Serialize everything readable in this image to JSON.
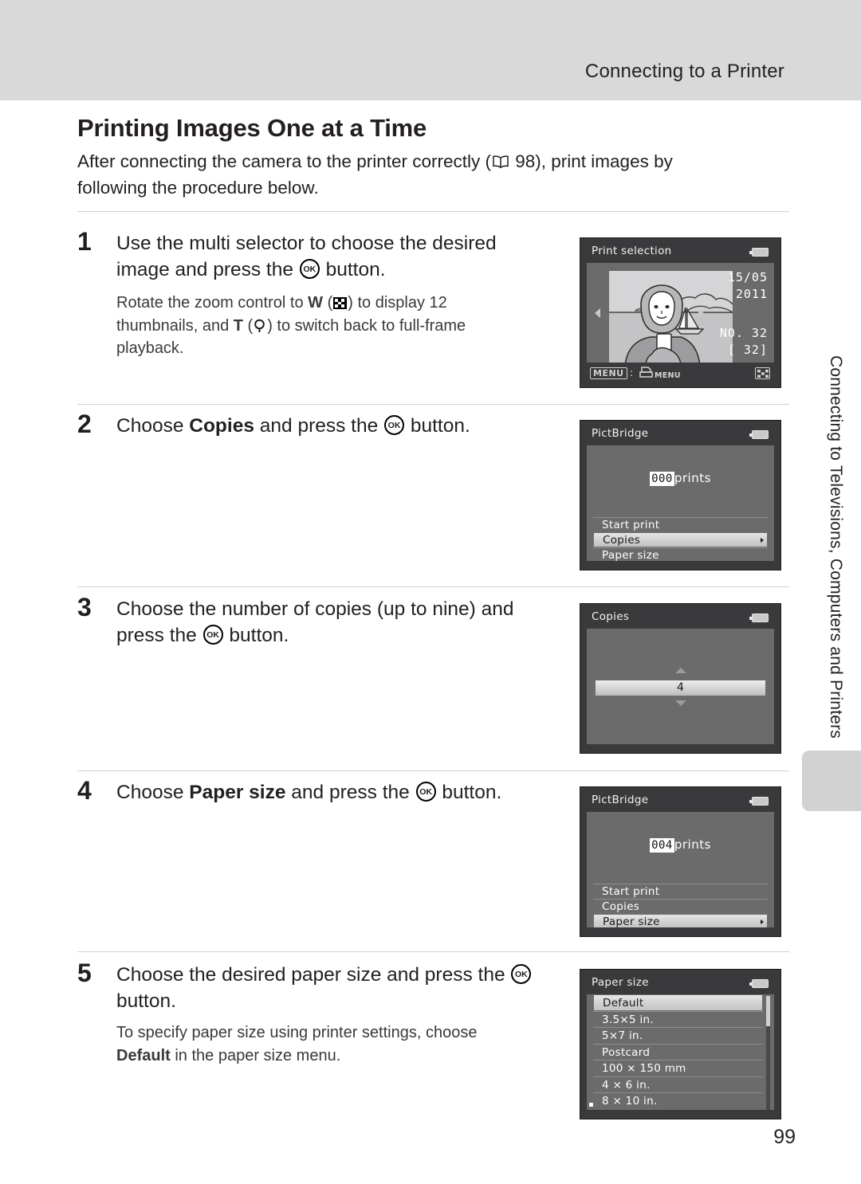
{
  "header": {
    "running_title": "Connecting to a Printer"
  },
  "doc": {
    "h1": "Printing Images One at a Time",
    "intro_a": "After connecting the camera to the printer correctly (",
    "intro_ref": "98",
    "intro_b": "), print images by following the procedure below.",
    "page_number": "99",
    "side_tab_text": "Connecting to Televisions, Computers and Printers"
  },
  "steps": [
    {
      "num": "1",
      "title_a": "Use the multi selector to choose the desired image and press the ",
      "title_b": " button.",
      "body_1": "Rotate the zoom control to ",
      "body_w": "W",
      "body_2": ") to display 12 thumbnails, and ",
      "body_t": "T",
      "body_3": ") to switch back to full-frame playback."
    },
    {
      "num": "2",
      "title_a": "Choose ",
      "title_bold": "Copies",
      "title_b": " and press the ",
      "title_c": " button."
    },
    {
      "num": "3",
      "title_a": "Choose the number of copies (up to nine) and press the ",
      "title_b": " button."
    },
    {
      "num": "4",
      "title_a": "Choose ",
      "title_bold": "Paper size",
      "title_b": " and press the ",
      "title_c": " button."
    },
    {
      "num": "5",
      "title_a": "Choose the desired paper size and press the ",
      "title_b": " button.",
      "body_a": "To specify paper size using printer settings, choose ",
      "body_bold": "Default",
      "body_b": " in the paper size menu."
    }
  ],
  "screens": {
    "print_selection": {
      "title": "Print selection",
      "date": "15/05",
      "year": "2011",
      "frame_no": "NO. 32",
      "frame_total": "[   32]",
      "menu_badge": "MENU",
      "menu_colon": ":",
      "printer_label": "MENU"
    },
    "pictbridge_copies": {
      "title": "PictBridge",
      "count": "000",
      "count_word": "prints",
      "items": [
        {
          "label": "Start print",
          "selected": false
        },
        {
          "label": "Copies",
          "selected": true
        },
        {
          "label": "Paper size",
          "selected": false
        }
      ]
    },
    "copies": {
      "title": "Copies",
      "value": "4"
    },
    "pictbridge_paper": {
      "title": "PictBridge",
      "count": "004",
      "count_word": "prints",
      "items": [
        {
          "label": "Start print",
          "selected": false
        },
        {
          "label": "Copies",
          "selected": false
        },
        {
          "label": "Paper size",
          "selected": true
        }
      ]
    },
    "paper_size": {
      "title": "Paper size",
      "items": [
        {
          "label": "Default",
          "selected": true
        },
        {
          "label": "3.5×5 in.",
          "selected": false
        },
        {
          "label": "5×7 in.",
          "selected": false
        },
        {
          "label": "Postcard",
          "selected": false
        },
        {
          "label": "100 × 150 mm",
          "selected": false
        },
        {
          "label": "4 × 6 in.",
          "selected": false
        },
        {
          "label": "8 × 10 in.",
          "selected": false
        }
      ]
    }
  },
  "colors": {
    "header_band": "#d9d9d9",
    "lcd_chrome": "#3a3a3c",
    "lcd_body": "#6b6b6b",
    "text": "#231f20"
  }
}
